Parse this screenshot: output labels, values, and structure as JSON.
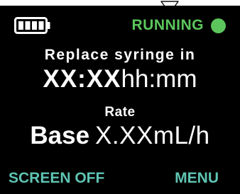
{
  "status": {
    "battery_icon": "battery-full-icon",
    "label": "RUNNING",
    "indicator_color": "#5cc65c"
  },
  "syringe": {
    "heading": "Replace syringe in",
    "time_placeholder": "XX:XX",
    "time_unit": "hh:mm"
  },
  "rate": {
    "heading": "Rate",
    "mode": "Base",
    "value_placeholder": "X.XX",
    "unit": "mL/h"
  },
  "softkeys": {
    "left_label": "SCREEN OFF",
    "right_label": "MENU",
    "color": "#5fc4b3"
  }
}
